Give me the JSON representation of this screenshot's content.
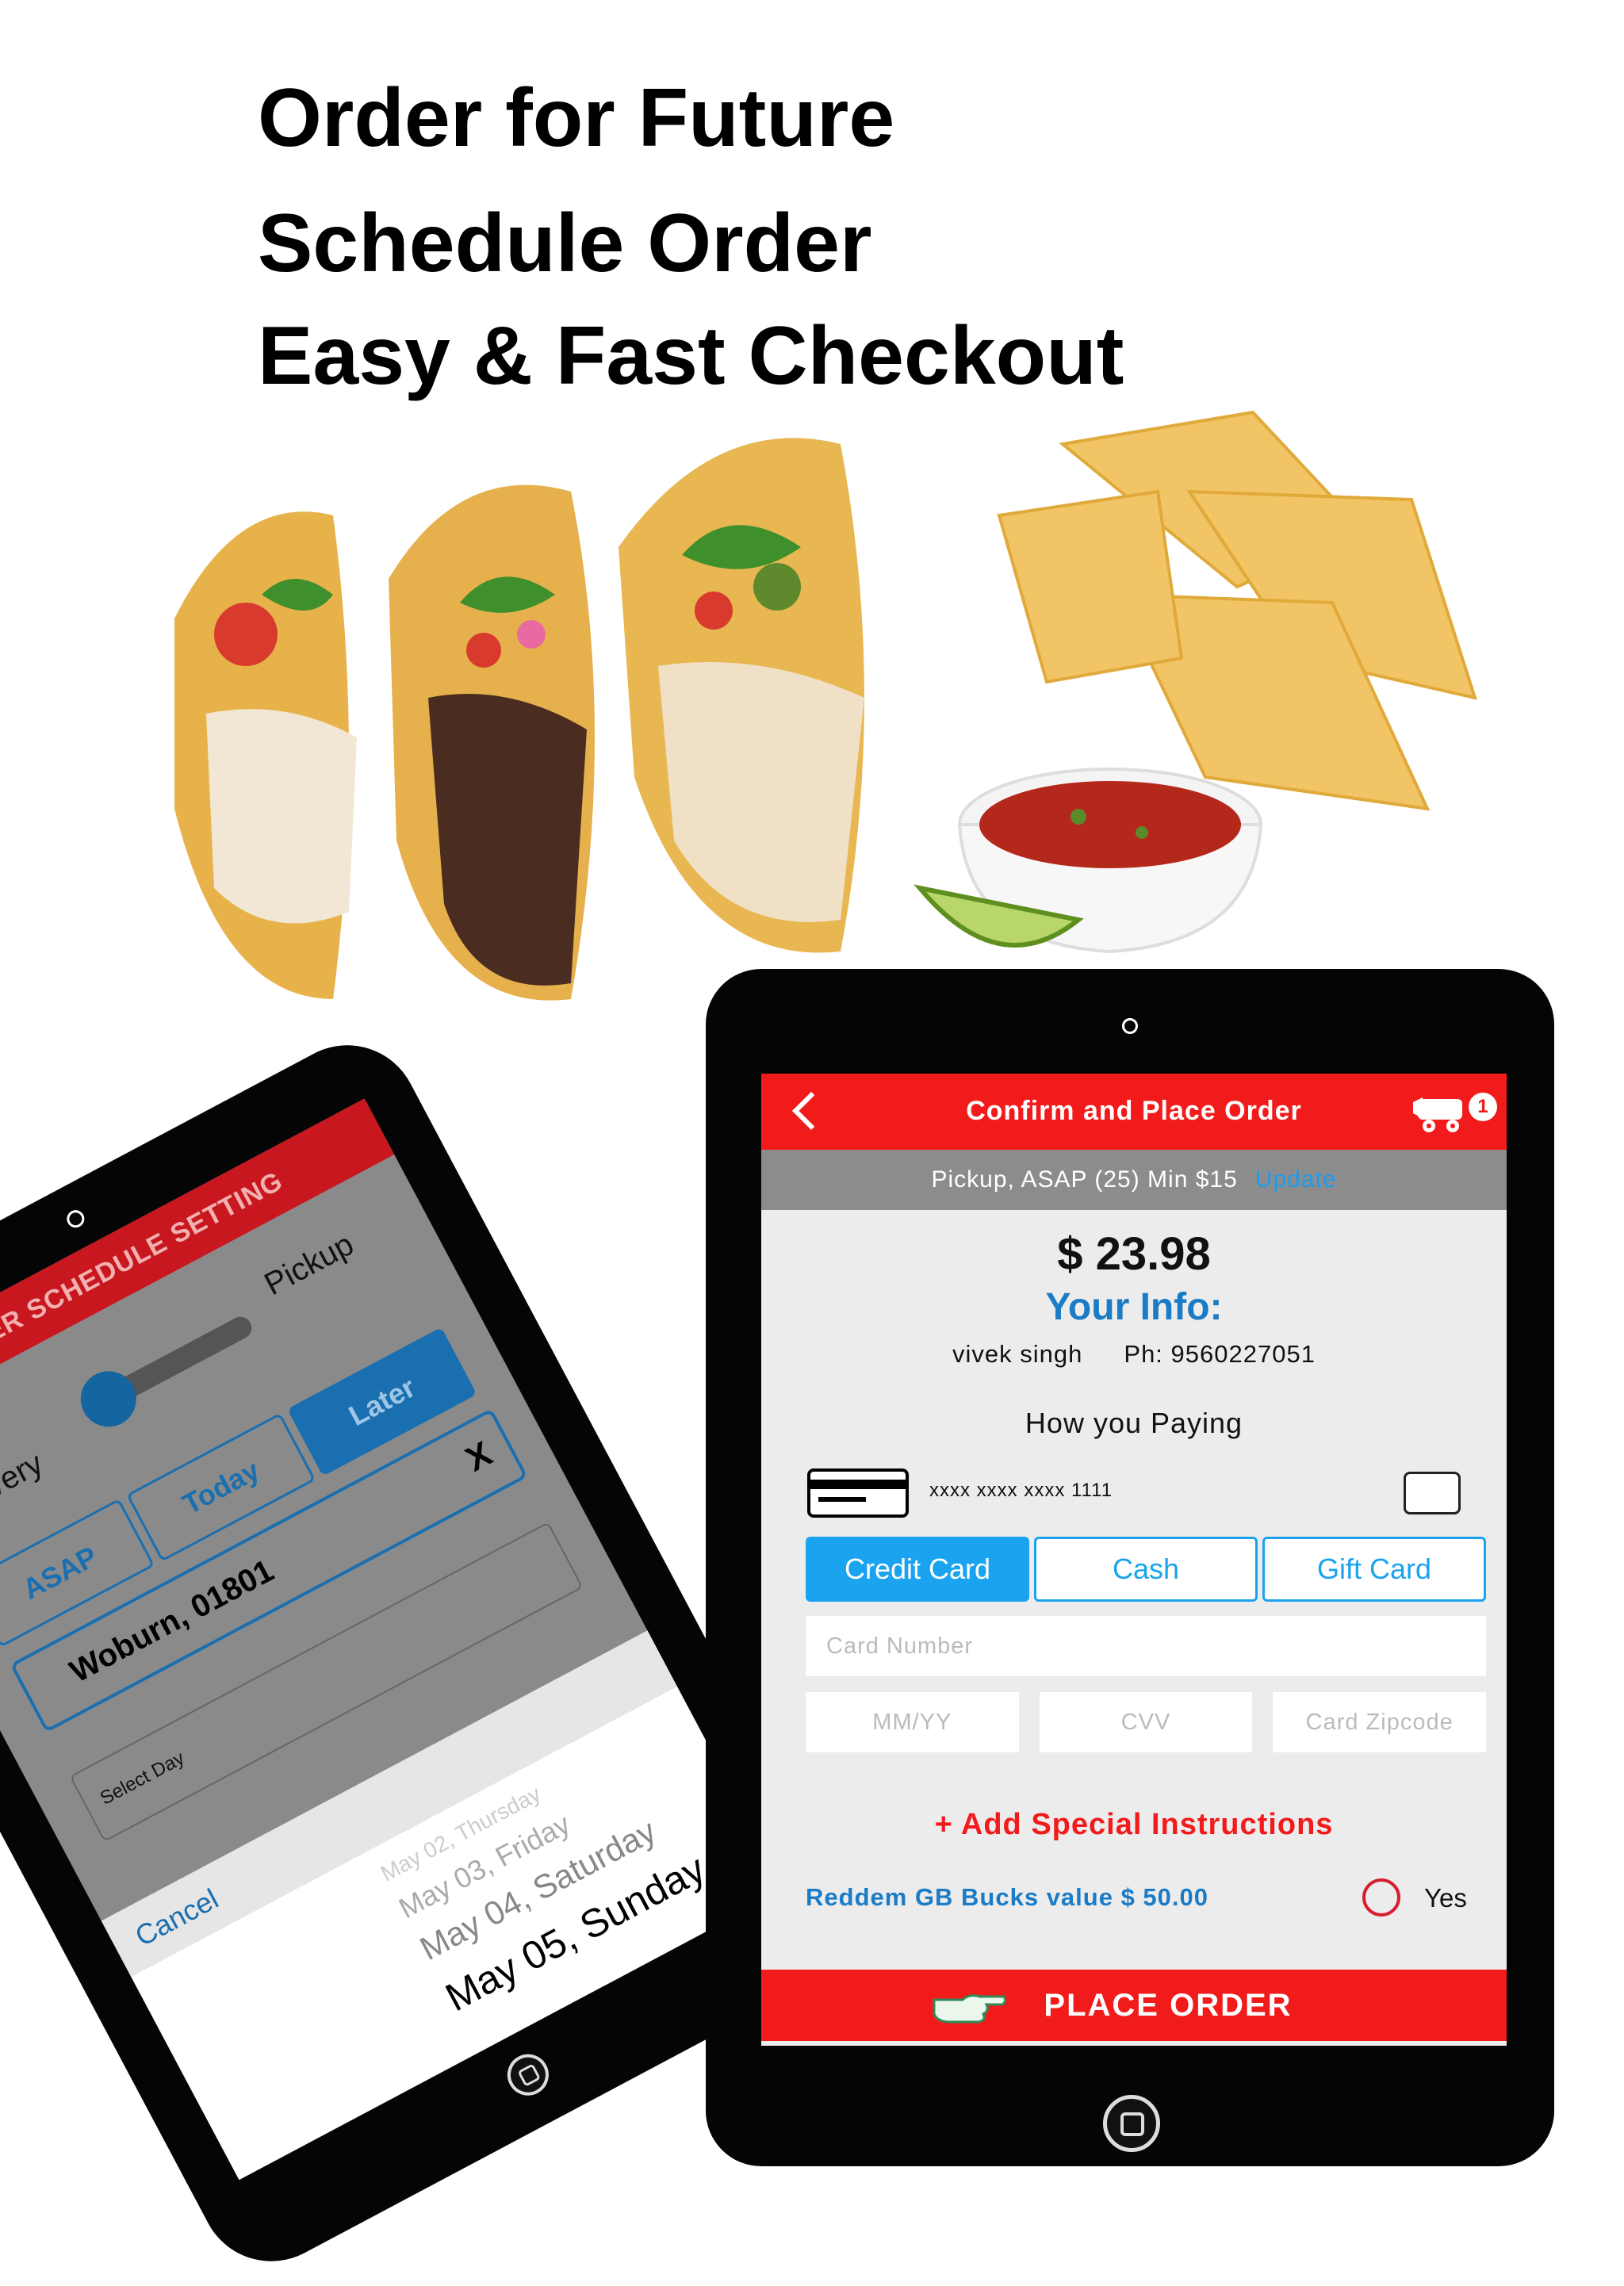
{
  "headlines": [
    "Order for Future",
    "Schedule Order",
    "Easy & Fast Checkout"
  ],
  "schedule": {
    "header": "ORDER SCHEDULE SETTING",
    "delivery_label": "Delivery",
    "pickup_label": "Pickup",
    "tabs": [
      "ASAP",
      "Today",
      "Later"
    ],
    "active_tab": "Later",
    "location": "Woburn, 01801",
    "clear": "X",
    "select_day": "Select Day",
    "cancel": "Cancel",
    "day_options": [
      "May 02, Thursday",
      "May 03, Friday",
      "May 04, Saturday",
      "May 05, Sunday"
    ],
    "selected_day": "May 05, Sunday"
  },
  "checkout": {
    "title": "Confirm and Place Order",
    "cart_count": "1",
    "order_summary": "Pickup, ASAP (25) Min $15",
    "update_link": "Update",
    "total": "$ 23.98",
    "info_title": "Your Info:",
    "customer_name": "vivek singh",
    "phone": "Ph: 9560227051",
    "paying_title": "How you Paying",
    "masked_card": "xxxx xxxx xxxx 1111",
    "payment_tabs": [
      "Credit Card",
      "Cash",
      "Gift Card"
    ],
    "active_payment": "Credit Card",
    "placeholders": {
      "card_number": "Card Number",
      "expiry": "MM/YY",
      "cvv": "CVV",
      "zip": "Card Zipcode"
    },
    "special_instructions": "+ Add Special Instructions",
    "bucks_label": "Reddem GB Bucks value $ 50.00",
    "yes_label": "Yes",
    "place_order": "PLACE ORDER"
  },
  "colors": {
    "header_red": "#f21b1b",
    "accent_blue": "#1aa3ee",
    "info_blue": "#1a7bc6",
    "schedule_red": "#c8171e",
    "schedule_blue": "#1a6fb0"
  }
}
